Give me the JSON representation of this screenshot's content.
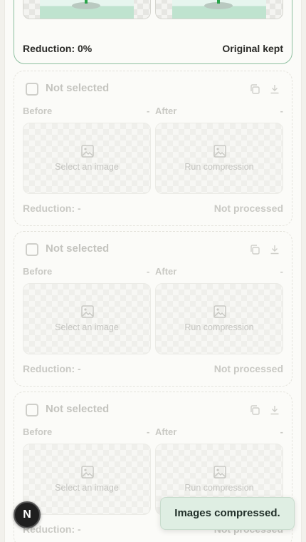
{
  "active_card": {
    "reduction": "Reduction: 0%",
    "result": "Original kept"
  },
  "cards": [
    {
      "title": "Not selected",
      "before_label": "Before",
      "before_value": "-",
      "after_label": "After",
      "after_value": "-",
      "before_hint": "Select an image",
      "after_hint": "Run compression",
      "reduction": "Reduction: -",
      "status": "Not processed",
      "icons": [
        "image-icon",
        "copy-icon",
        "download-icon"
      ]
    },
    {
      "title": "Not selected",
      "before_label": "Before",
      "before_value": "-",
      "after_label": "After",
      "after_value": "-",
      "before_hint": "Select an image",
      "after_hint": "Run compression",
      "reduction": "Reduction: -",
      "status": "Not processed"
    },
    {
      "title": "Not selected",
      "before_label": "Before",
      "before_value": "-",
      "after_label": "After",
      "after_value": "-",
      "before_hint": "Select an image",
      "after_hint": "Run compression",
      "reduction": "Reduction: -",
      "status": "Not processed"
    }
  ],
  "fab": {
    "label": "N"
  },
  "toast": {
    "message": "Images compressed."
  },
  "colors": {
    "accent_border": "#8dbf9f",
    "toast_bg": "#dfeee3",
    "muted_text": "#c4c4bf"
  }
}
